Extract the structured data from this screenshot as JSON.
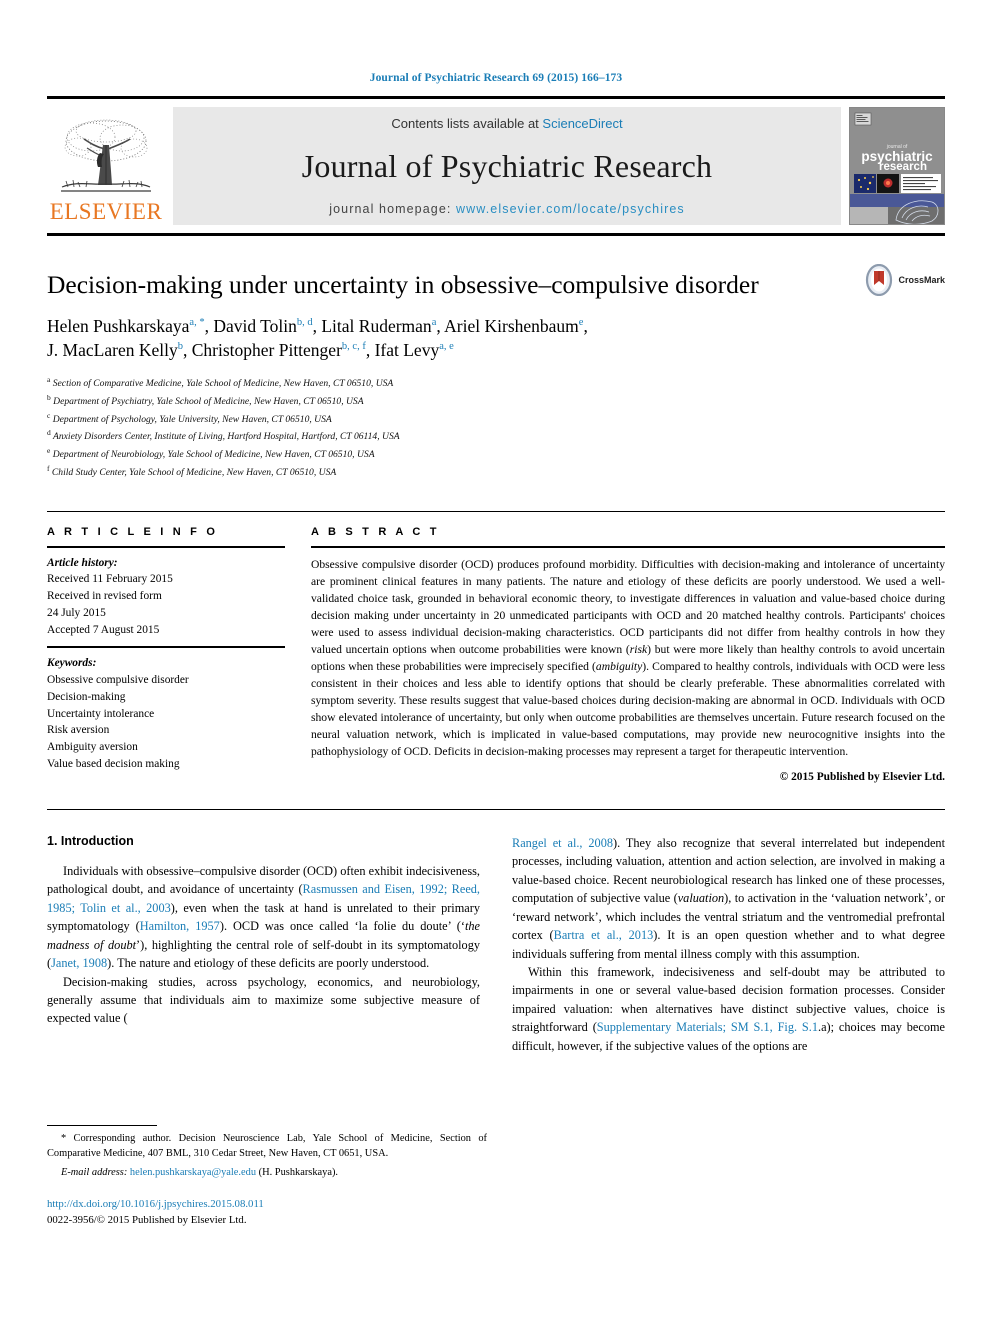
{
  "running_head": "Journal of Psychiatric Research 69 (2015) 166–173",
  "masthead": {
    "publisher_name": "ELSEVIER",
    "contents_prefix": "Contents lists available at ",
    "sciencedirect": "ScienceDirect",
    "journal_name": "Journal of Psychiatric Research",
    "homepage_prefix": "journal homepage: ",
    "homepage_url": "www.elsevier.com/locate/psychires",
    "cover_title_line1": "psychiatric",
    "cover_title_line2": "research",
    "cover_kicker": "journal of"
  },
  "article": {
    "title": "Decision-making under uncertainty in obsessive–compulsive disorder",
    "crossmark_label": "CrossMark",
    "authors_line1": "Helen Pushkarskaya",
    "authors": [
      {
        "name": "Helen Pushkarskaya",
        "marks": "a, *"
      },
      {
        "name": "David Tolin",
        "marks": "b, d"
      },
      {
        "name": "Lital Ruderman",
        "marks": "a"
      },
      {
        "name": "Ariel Kirshenbaum",
        "marks": "e"
      },
      {
        "name": "J. MacLaren Kelly",
        "marks": "b"
      },
      {
        "name": "Christopher Pittenger",
        "marks": "b, c, f"
      },
      {
        "name": "Ifat Levy",
        "marks": "a, e"
      }
    ],
    "affiliations": [
      {
        "mark": "a",
        "text": "Section of Comparative Medicine, Yale School of Medicine, New Haven, CT 06510, USA"
      },
      {
        "mark": "b",
        "text": "Department of Psychiatry, Yale School of Medicine, New Haven, CT 06510, USA"
      },
      {
        "mark": "c",
        "text": "Department of Psychology, Yale University, New Haven, CT 06510, USA"
      },
      {
        "mark": "d",
        "text": "Anxiety Disorders Center, Institute of Living, Hartford Hospital, Hartford, CT 06114, USA"
      },
      {
        "mark": "e",
        "text": "Department of Neurobiology, Yale School of Medicine, New Haven, CT 06510, USA"
      },
      {
        "mark": "f",
        "text": "Child Study Center, Yale School of Medicine, New Haven, CT 06510, USA"
      }
    ]
  },
  "article_info": {
    "heading": "A R T I C L E   I N F O",
    "history_label": "Article history:",
    "history_lines": [
      "Received 11 February 2015",
      "Received in revised form",
      "24 July 2015",
      "Accepted 7 August 2015"
    ],
    "keywords_label": "Keywords:",
    "keywords": [
      "Obsessive compulsive disorder",
      "Decision-making",
      "Uncertainty intolerance",
      "Risk aversion",
      "Ambiguity aversion",
      "Value based decision making"
    ]
  },
  "abstract": {
    "heading": "A B S T R A C T",
    "text_part1": "Obsessive compulsive disorder (OCD) produces profound morbidity. Difficulties with decision-making and intolerance of uncertainty are prominent clinical features in many patients. The nature and etiology of these deficits are poorly understood. We used a well-validated choice task, grounded in behavioral economic theory, to investigate differences in valuation and value-based choice during decision making under uncertainty in 20 unmedicated participants with OCD and 20 matched healthy controls. Participants' choices were used to assess individual decision-making characteristics. OCD participants did not differ from healthy controls in how they valued uncertain options when outcome probabilities were known (",
    "italic1": "risk",
    "text_part2": ") but were more likely than healthy controls to avoid uncertain options when these probabilities were imprecisely specified (",
    "italic2": "ambiguity",
    "text_part3": "). Compared to healthy controls, individuals with OCD were less consistent in their choices and less able to identify options that should be clearly preferable. These abnormalities correlated with symptom severity. These results suggest that value-based choices during decision-making are abnormal in OCD. Individuals with OCD show elevated intolerance of uncertainty, but only when outcome probabilities are themselves uncertain. Future research focused on the neural valuation network, which is implicated in value-based computations, may provide new neurocognitive insights into the pathophysiology of OCD. Deficits in decision-making processes may represent a target for therapeutic intervention.",
    "copyright": "© 2015 Published by Elsevier Ltd."
  },
  "introduction": {
    "heading": "1. Introduction",
    "p1_a": "Individuals with obsessive–compulsive disorder (OCD) often exhibit indecisiveness, pathological doubt, and avoidance of uncertainty (",
    "p1_cite1": "Rasmussen and Eisen, 1992; Reed, 1985; Tolin et al., 2003",
    "p1_b": "), even when the task at hand is unrelated to their primary symptomatology (",
    "p1_cite2": "Hamilton, 1957",
    "p1_c": "). OCD was once called ‘la folie du doute’ (‘",
    "p1_italic": "the madness of doubt",
    "p1_d": "’), highlighting the central role of self-doubt in its symptomatology (",
    "p1_cite3": "Janet, 1908",
    "p1_e": "). The nature and etiology of these deficits are poorly understood.",
    "p2_a": "Decision-making studies, across psychology, economics, and neurobiology, generally assume that individuals aim to maximize some subjective measure of expected value (",
    "p2_cite1": "Rangel et al., 2008",
    "p2_b": "). They also recognize that several interrelated but independent processes, including valuation, attention and action selection, are involved in making a value-based choice. Recent neurobiological research has linked one of these processes, computation of subjective value (",
    "p2_italic": "valuation",
    "p2_c": "), to activation in the ‘valuation network’, or ‘reward network’, which includes the ventral striatum and the ventromedial prefrontal cortex (",
    "p2_cite2": "Bartra et al., 2013",
    "p2_d": "). It is an open question whether and to what degree individuals suffering from mental illness comply with this assumption.",
    "p3_a": "Within this framework, indecisiveness and self-doubt may be attributed to impairments in one or several value-based decision formation processes. Consider impaired valuation: when alternatives have distinct subjective values, choice is straightforward (",
    "p3_cite1": "Supplementary Materials; SM S.1, Fig. S.1",
    "p3_b": ".a); choices may become difficult, however, if the subjective values of the options are"
  },
  "footnote": {
    "corresponding": "* Corresponding author. Decision Neuroscience Lab, Yale School of Medicine, Section of Comparative Medicine, 407 BML, 310 Cedar Street, New Haven, CT 0651, USA.",
    "email_label": "E-mail address:",
    "email": "helen.pushkarskaya@yale.edu",
    "email_suffix": "(H. Pushkarskaya).",
    "doi": "http://dx.doi.org/10.1016/j.jpsychires.2015.08.011",
    "issn_line": "0022-3956/© 2015 Published by Elsevier Ltd."
  },
  "colors": {
    "link": "#1a7db6",
    "elsevier_orange": "#E87722",
    "masthead_grey": "#e8e8e8"
  }
}
